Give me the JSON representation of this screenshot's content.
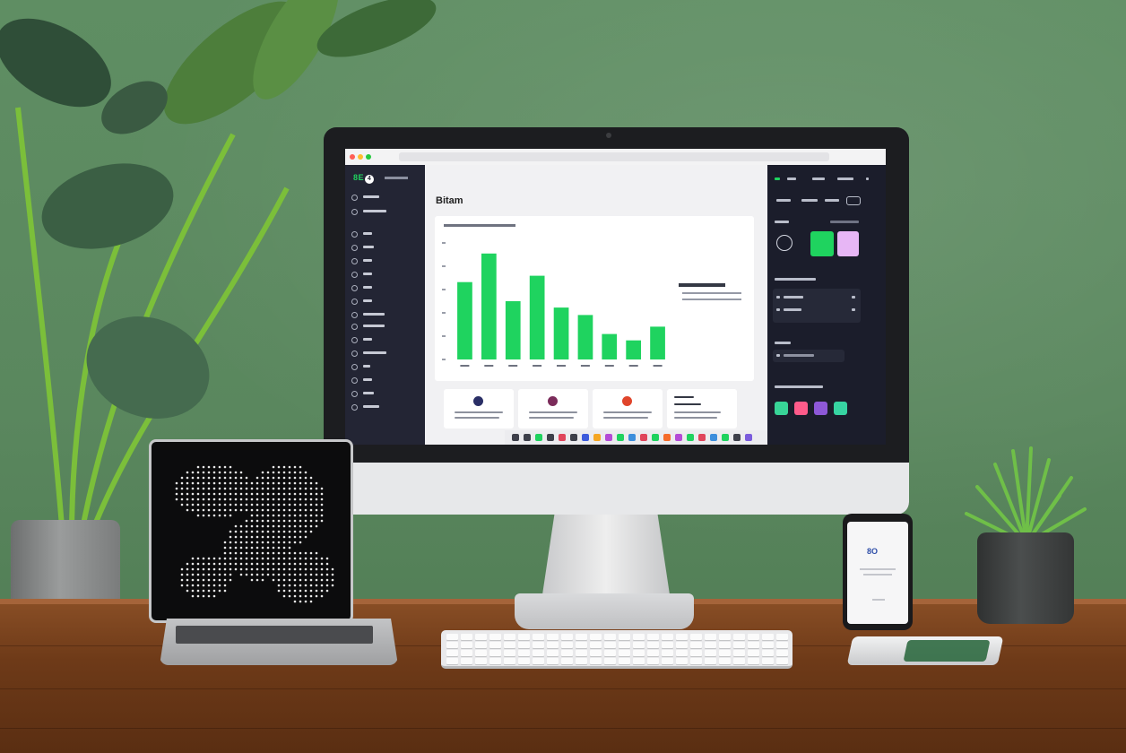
{
  "scene": {
    "description_free_labels": false,
    "accent_green": "#1fd35f",
    "wall_color": "#5f8e63",
    "desk_color": "#6e3a18"
  },
  "app": {
    "brand": "8E",
    "brand_badge": "4",
    "page_title": "Bitam",
    "sidebar_item_count": 16,
    "right_panel": {
      "swatch_colors": [
        "#1fd35f",
        "#e7b6f5"
      ],
      "tile_colors": [
        "#38d497",
        "#ff5b8a",
        "#8e58d8",
        "#37d4a2"
      ]
    }
  },
  "chart_data": {
    "type": "bar",
    "values": [
      73,
      100,
      55,
      79,
      49,
      42,
      24,
      18,
      31
    ],
    "ylim": [
      0,
      110
    ],
    "bar_color": "#1fd35f",
    "grid": false,
    "legend_position": "right"
  },
  "dock": {
    "icon_colors": [
      "#3d3f4a",
      "#3d3f4a",
      "#1fd35f",
      "#3d3f4a",
      "#e0455b",
      "#3d3f4a",
      "#3c5bdc",
      "#f5a623",
      "#b44bd6",
      "#1fd35f",
      "#3c8edc",
      "#e0455b",
      "#1fd35f",
      "#f56b2a",
      "#b44bd6",
      "#1fd35f",
      "#e0455b",
      "#3c8edc",
      "#1fd35f",
      "#3d3f4a",
      "#7a5bdc"
    ]
  },
  "phone": {
    "brand": "8O"
  }
}
